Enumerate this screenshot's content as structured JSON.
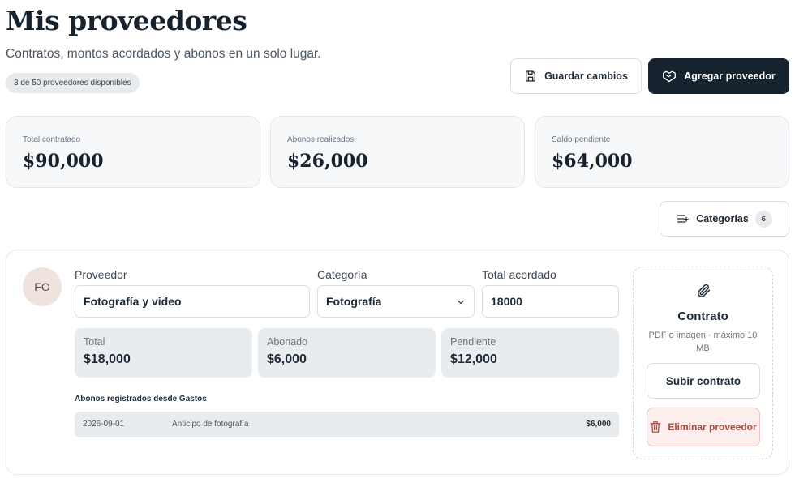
{
  "header": {
    "title": "Mis proveedores",
    "subtitle": "Contratos, montos acordados y abonos en un solo lugar.",
    "badge": "3 de 50 proveedores disponibles"
  },
  "actions": {
    "save_label": "Guardar cambios",
    "add_label": "Agregar proveedor"
  },
  "stats": [
    {
      "label": "Total contratado",
      "value": "$90,000"
    },
    {
      "label": "Abonos realizados",
      "value": "$26,000"
    },
    {
      "label": "Saldo pendiente",
      "value": "$64,000"
    }
  ],
  "categories_button": {
    "label": "Categorías",
    "count": "6"
  },
  "supplier": {
    "initials": "FO",
    "provider_label": "Proveedor",
    "provider_value": "Fotografía y video",
    "category_label": "Categoría",
    "category_value": "Fotografía",
    "total_label": "Total acordado",
    "total_value": "18000",
    "summary": [
      {
        "label": "Total",
        "value": "$18,000"
      },
      {
        "label": "Abonado",
        "value": "$6,000"
      },
      {
        "label": "Pendiente",
        "value": "$12,000"
      }
    ],
    "payments_label": "Abonos registrados desde Gastos",
    "payments": [
      {
        "date": "2026-09-01",
        "description": "Anticipo de fotografía",
        "amount": "$6,000"
      }
    ],
    "contract": {
      "title": "Contrato",
      "hint": "PDF o imagen · máximo 10 MB",
      "upload_label": "Subir contrato",
      "delete_label": "Eliminar proveedor"
    }
  },
  "colors": {
    "primary": "#17222f",
    "danger": "#b0473c",
    "danger_bg": "#fbeeec"
  }
}
